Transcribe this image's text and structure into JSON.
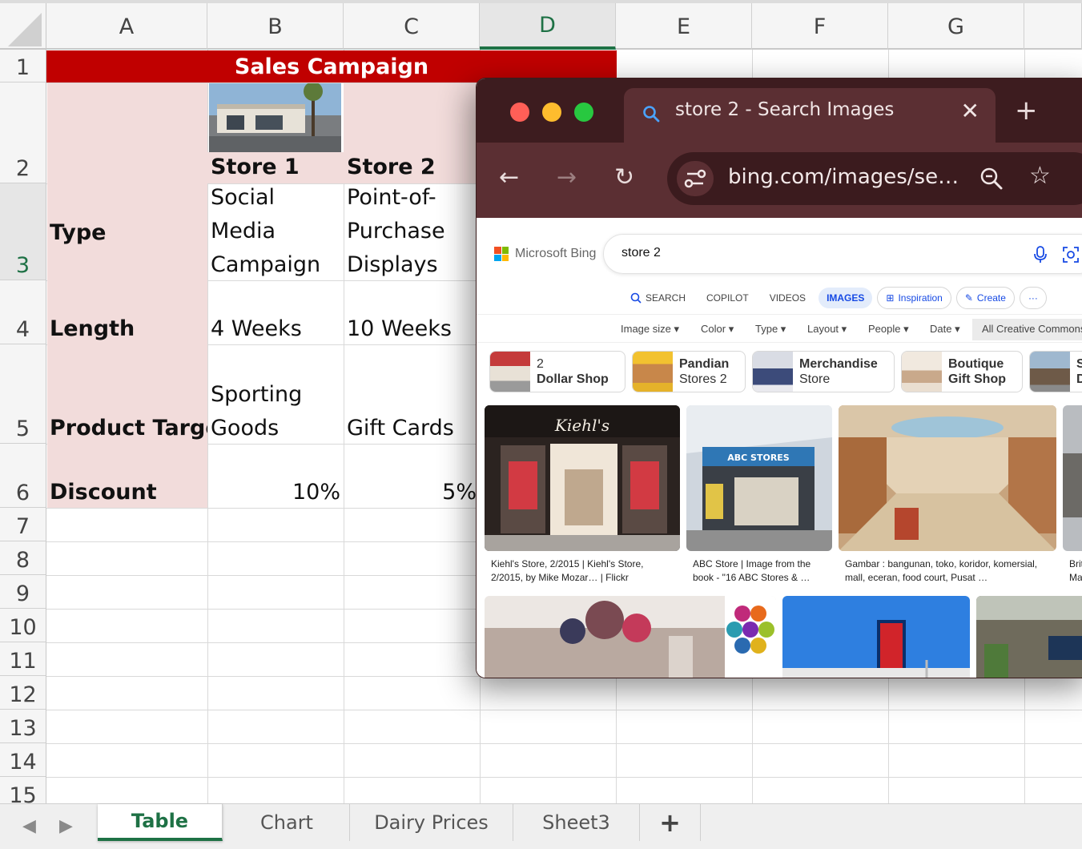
{
  "sheet": {
    "columns": [
      "A",
      "B",
      "C",
      "D",
      "E",
      "F",
      "G"
    ],
    "rows": [
      "1",
      "2",
      "3",
      "4",
      "5",
      "6",
      "7",
      "8",
      "9",
      "10",
      "11",
      "12",
      "13",
      "14",
      "15"
    ],
    "title": "Sales Campaign",
    "store1": "Store 1",
    "store2": "Store 2",
    "labels": {
      "type": "Type",
      "length": "Length",
      "product_target": "Product Targe",
      "discount": "Discount"
    },
    "type_store1": [
      "Social",
      "Media",
      "Campaign"
    ],
    "type_store2": [
      "Point-of-",
      "Purchase",
      "Displays"
    ],
    "length_store1": "4 Weeks",
    "length_store2": "10 Weeks",
    "target_store1": [
      "Sporting",
      "Goods"
    ],
    "target_store2": "Gift Cards",
    "discount_store1": "10%",
    "discount_store2": "5%",
    "tabs": [
      "Table",
      "Chart",
      "Dairy Prices",
      "Sheet3"
    ],
    "add_sheet": "+",
    "accent_color": "#1e7145",
    "title_color": "#c00000",
    "label_fill": "#f2dcdb"
  },
  "browser": {
    "tab_title": "store 2 - Search Images",
    "url": "bing.com/images/se…",
    "bing": {
      "brand": "Microsoft Bing",
      "query": "store 2",
      "scopes": [
        "SEARCH",
        "COPILOT",
        "VIDEOS",
        "IMAGES",
        "Inspiration",
        "Create",
        "···"
      ],
      "filters": [
        "Image size",
        "Color",
        "Type",
        "Layout",
        "People",
        "Date",
        "All Creative Commons"
      ],
      "chips": [
        {
          "l1": "2",
          "l2": "Dollar Shop"
        },
        {
          "l1": "Pandian",
          "l2": "Stores 2"
        },
        {
          "l1": "Merchandise",
          "l2": "Store"
        },
        {
          "l1": "Boutique",
          "l2": "Gift Shop"
        },
        {
          "l1": "S",
          "l2": "D"
        }
      ],
      "results": [
        {
          "l1": "Kiehl's Store, 2/2015 | Kiehl's Store,",
          "l2": "2/2015, by Mike Mozar… | Flickr"
        },
        {
          "l1": "ABC Store | Image from the",
          "l2": "book - \"16 ABC Stores & …"
        },
        {
          "l1": "Gambar : bangunan, toko, koridor, komersial,",
          "l2": "mall, eceran, food court, Pusat …"
        },
        {
          "l1": "Brit",
          "l2": "Ma"
        }
      ],
      "image_text": {
        "kiehls": "Kiehl's",
        "abc": "ABC STORES"
      }
    }
  }
}
